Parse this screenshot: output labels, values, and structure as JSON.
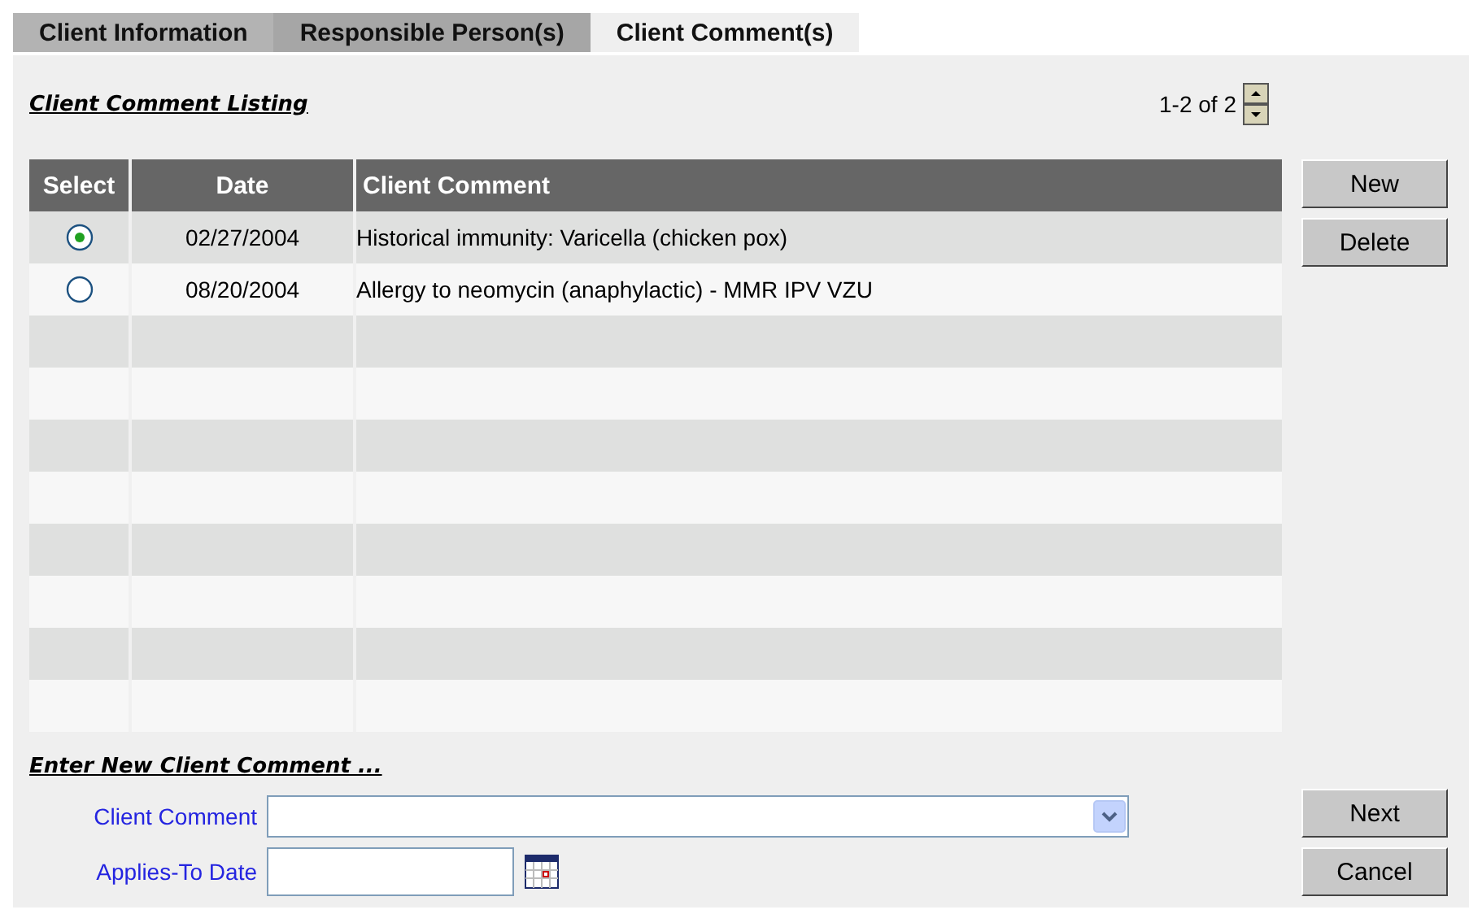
{
  "tabs": [
    {
      "label": "Client Information",
      "selected": false
    },
    {
      "label": "Responsible Person(s)",
      "selected": false
    },
    {
      "label": "Client Comment(s)",
      "selected": true
    }
  ],
  "listing": {
    "title": "Client Comment Listing",
    "pager": "1-2 of 2",
    "columns": [
      "Select",
      "Date",
      "Client Comment"
    ],
    "rows": [
      {
        "selected": true,
        "date": "02/27/2004",
        "comment": "Historical immunity: Varicella (chicken pox)"
      },
      {
        "selected": false,
        "date": "08/20/2004",
        "comment": "Allergy to neomycin (anaphylactic) - MMR IPV VZU"
      }
    ],
    "buttons": [
      "New",
      "Delete"
    ]
  },
  "form": {
    "title": "Enter New Client Comment ...",
    "fields": [
      {
        "kind": "dropdown",
        "label": "Client Comment"
      },
      {
        "kind": "date",
        "label": "Applies-To Date"
      }
    ],
    "buttons": [
      "Next",
      "Cancel"
    ]
  }
}
